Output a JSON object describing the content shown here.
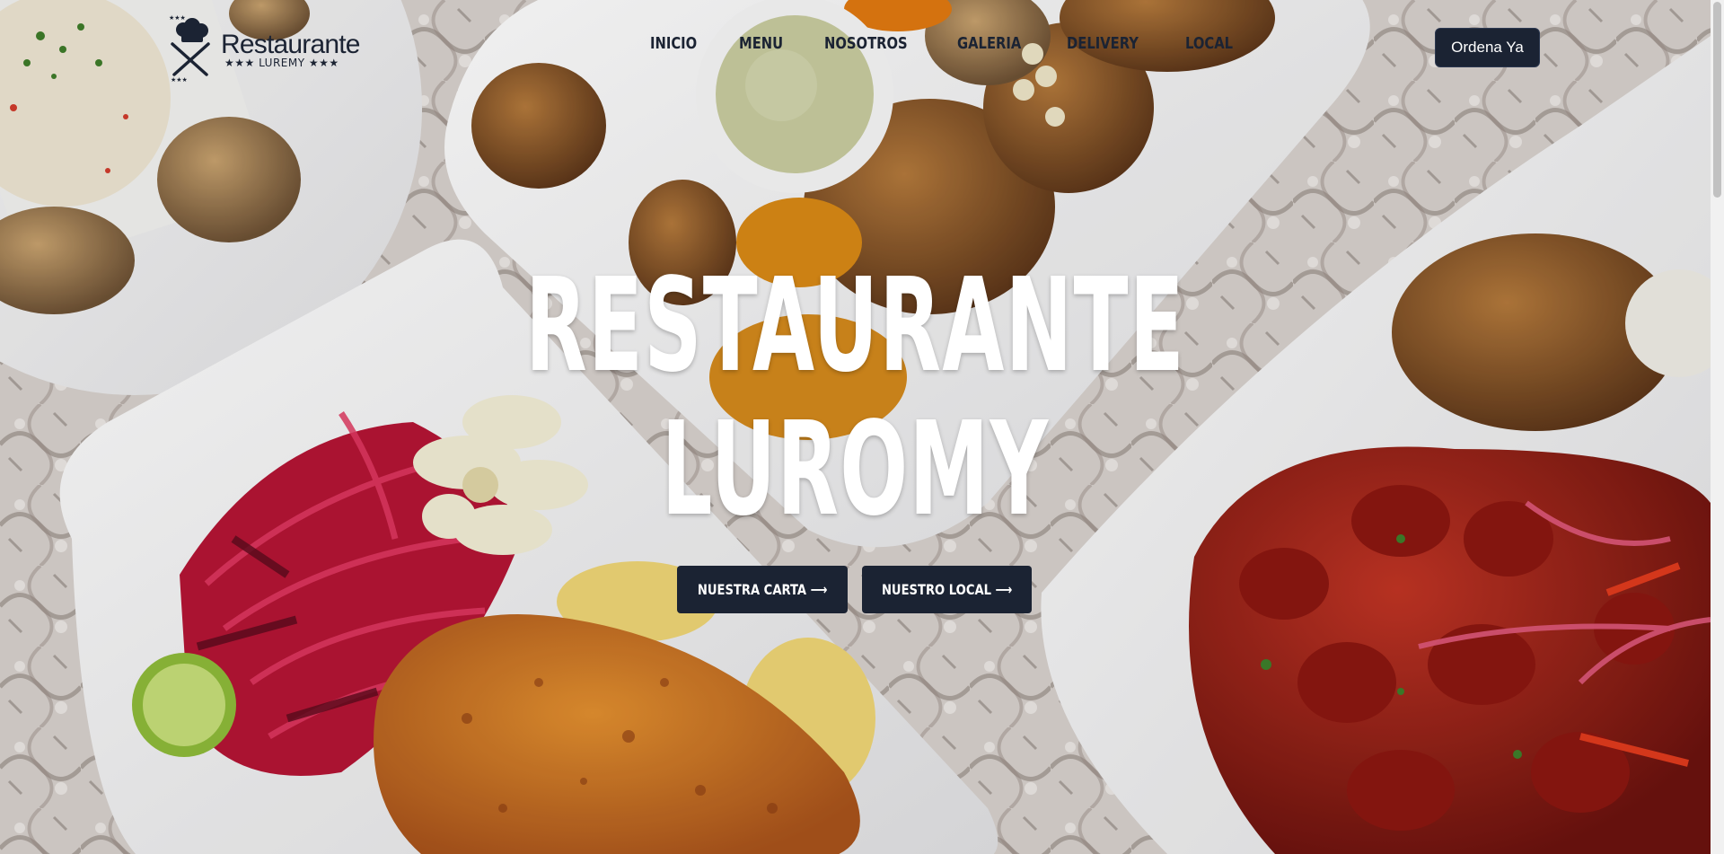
{
  "brand": {
    "name": "Restaurante",
    "tagline": "★★★ LUREMY ★★★"
  },
  "nav": {
    "items": [
      {
        "label": "INICIO"
      },
      {
        "label": "MENU"
      },
      {
        "label": "NOSOTROS"
      },
      {
        "label": "GALERIA"
      },
      {
        "label": "DELIVERY"
      },
      {
        "label": "LOCAL"
      }
    ]
  },
  "cta": {
    "label": "Ordena Ya"
  },
  "hero": {
    "title_line1": "RESTAURANTE",
    "title_line2": "LUROMY",
    "buttons": [
      {
        "label": "NUESTRA CARTA ⟶"
      },
      {
        "label": "NUESTRO LOCAL ⟶"
      }
    ]
  },
  "colors": {
    "navy": "#1b2333",
    "white": "#ffffff",
    "tablecloth": "#d9d4d0"
  },
  "icons": {
    "logo": "chef-hat-crossed-utensils-icon",
    "arrow": "long-right-arrow-icon"
  }
}
